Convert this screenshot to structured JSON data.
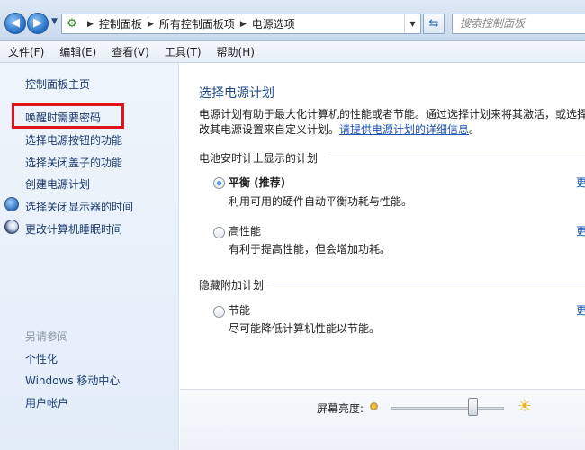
{
  "address_bar": {
    "crumbs": [
      "控制面板",
      "所有控制面板项",
      "电源选项"
    ],
    "search_placeholder": "搜索控制面板"
  },
  "menu": [
    "文件(F)",
    "编辑(E)",
    "查看(V)",
    "工具(T)",
    "帮助(H)"
  ],
  "sidebar": {
    "home": "控制面板主页",
    "links": [
      "唤醒时需要密码",
      "选择电源按钮的功能",
      "选择关闭盖子的功能",
      "创建电源计划",
      "选择关闭显示器的时间",
      "更改计算机睡眠时间"
    ],
    "see_also_heading": "另请参阅",
    "see_also": [
      "个性化",
      "Windows 移动中心",
      "用户帐户"
    ]
  },
  "main": {
    "title": "选择电源计划",
    "desc_line1": "电源计划有助于最大化计算机的性能或者节能。通过选择计划来将其激活，或选择",
    "desc_line2_prefix": "改其电源设置来自定义计划。",
    "desc_link": "请提供电源计划的详细信息",
    "desc_line2_suffix": "。",
    "group1": "电池安时计上显示的计划",
    "group2": "隐藏附加计划",
    "plans": [
      {
        "name": "平衡 (推荐)",
        "desc": "利用可用的硬件自动平衡功耗与性能。",
        "checked": true
      },
      {
        "name": "高性能",
        "desc": "有利于提高性能，但会增加功耗。",
        "checked": false
      },
      {
        "name": "节能",
        "desc": "尽可能降低计算机性能以节能。",
        "checked": false
      }
    ],
    "more_link": "更"
  },
  "brightness": {
    "label": "屏幕亮度:",
    "level": 0.75
  }
}
